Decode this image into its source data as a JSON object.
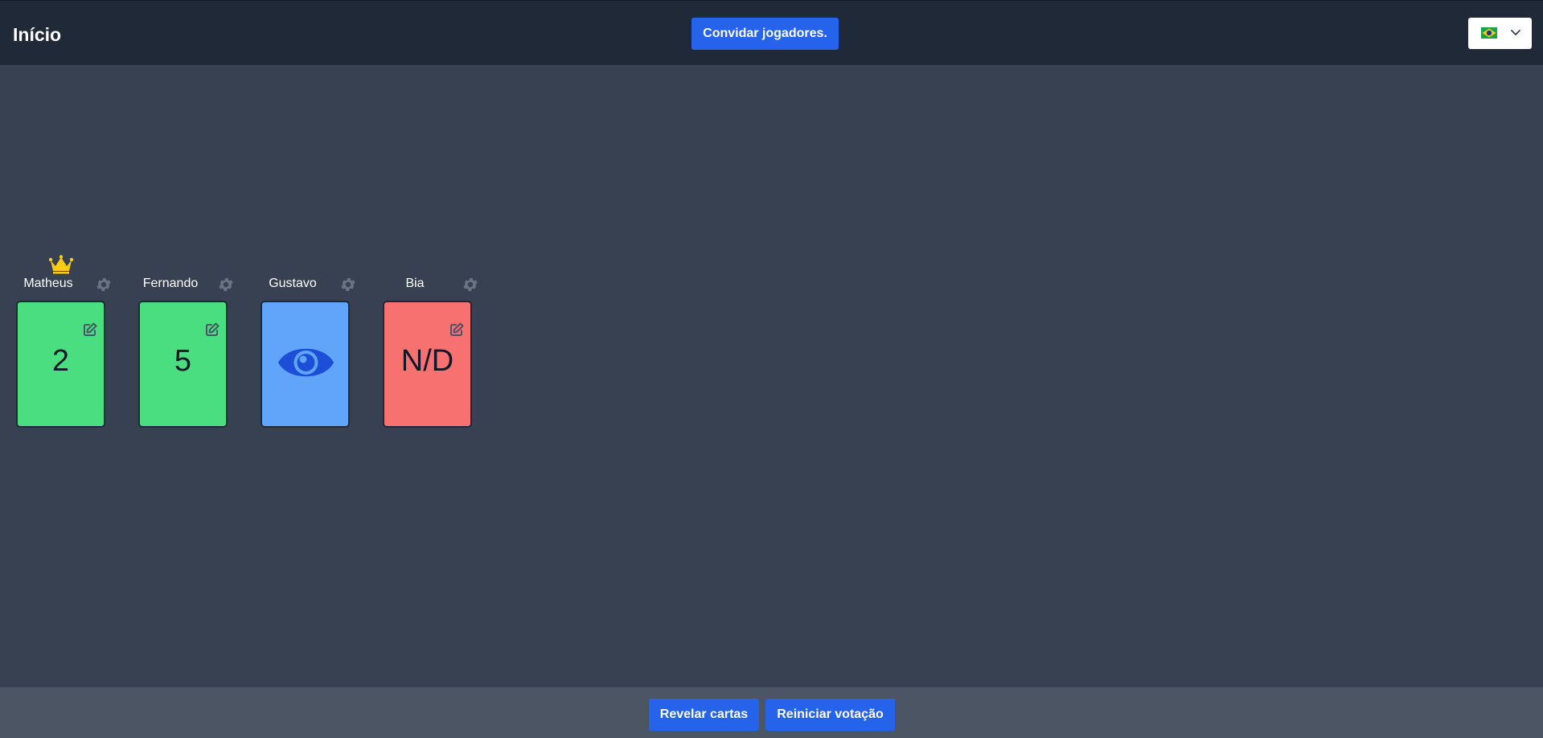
{
  "header": {
    "title": "Início",
    "invite_label": "Convidar jogadores.",
    "language": {
      "selected": "Português (Brasil)",
      "flag_icon": "brazil-flag-icon",
      "dropdown_icon": "chevron-down-icon"
    }
  },
  "players": [
    {
      "name": "Matheus",
      "is_host": true,
      "host_icon": "crown-icon",
      "card": {
        "value": "2",
        "status": "voted",
        "color": "#4ade80",
        "icon": "edit-icon"
      }
    },
    {
      "name": "Fernando",
      "is_host": false,
      "card": {
        "value": "5",
        "status": "voted",
        "color": "#4ade80",
        "icon": "edit-icon"
      }
    },
    {
      "name": "Gustavo",
      "is_host": false,
      "card": {
        "value": "",
        "status": "spectator",
        "color": "#60a5fa",
        "icon": "eye-icon"
      }
    },
    {
      "name": "Bia",
      "is_host": false,
      "card": {
        "value": "N/D",
        "status": "not-voted",
        "color": "#f87171",
        "icon": "edit-icon"
      }
    }
  ],
  "footer": {
    "reveal_label": "Revelar cartas",
    "restart_label": "Reiniciar votação"
  },
  "colors": {
    "header_bg": "#1f2937",
    "page_bg": "#374151",
    "footer_bg": "#4b5563",
    "primary_button": "#2563eb",
    "crown": "#facc15"
  }
}
